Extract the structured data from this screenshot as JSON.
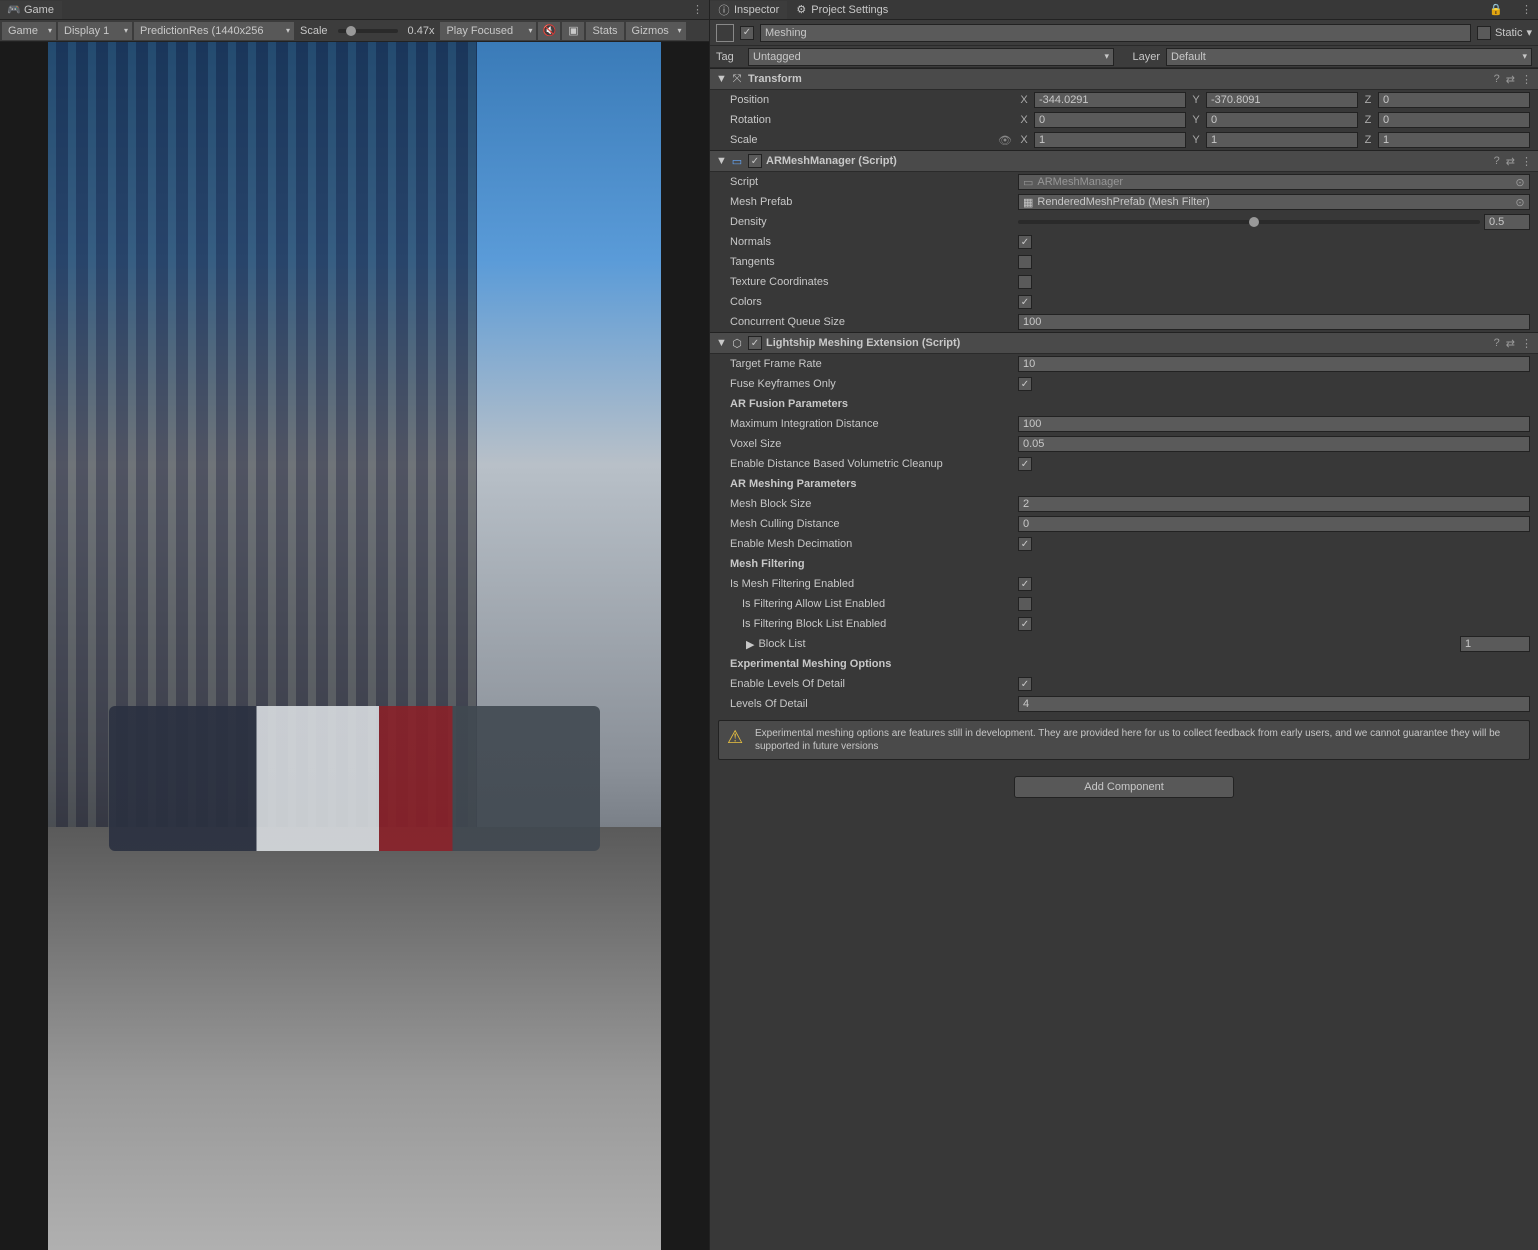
{
  "game_tab": {
    "label": "Game"
  },
  "game_toolbar": {
    "mode": "Game",
    "display": "Display 1",
    "resolution": "PredictionRes (1440x256",
    "scale_label": "Scale",
    "scale_value": "0.47x",
    "play_mode": "Play Focused",
    "stats": "Stats",
    "gizmos": "Gizmos"
  },
  "inspector_tab": {
    "label": "Inspector"
  },
  "settings_tab": {
    "label": "Project Settings"
  },
  "object": {
    "enabled": true,
    "name": "Meshing",
    "static_label": "Static",
    "tag_label": "Tag",
    "tag": "Untagged",
    "layer_label": "Layer",
    "layer": "Default"
  },
  "transform": {
    "title": "Transform",
    "position_label": "Position",
    "rotation_label": "Rotation",
    "scale_label": "Scale",
    "pos": {
      "x": "-344.0291",
      "y": "-370.8091",
      "z": "0"
    },
    "rot": {
      "x": "0",
      "y": "0",
      "z": "0"
    },
    "scale": {
      "x": "1",
      "y": "1",
      "z": "1"
    }
  },
  "armesh": {
    "title": "ARMeshManager (Script)",
    "script_label": "Script",
    "script_value": "ARMeshManager",
    "mesh_prefab_label": "Mesh Prefab",
    "mesh_prefab_value": "RenderedMeshPrefab (Mesh Filter)",
    "density_label": "Density",
    "density_value": "0.5",
    "normals_label": "Normals",
    "tangents_label": "Tangents",
    "texcoords_label": "Texture Coordinates",
    "colors_label": "Colors",
    "queue_label": "Concurrent Queue Size",
    "queue_value": "100"
  },
  "lightship": {
    "title": "Lightship Meshing Extension (Script)",
    "target_fr_label": "Target Frame Rate",
    "target_fr_value": "10",
    "fuse_label": "Fuse Keyframes Only",
    "fusion_header": "AR Fusion Parameters",
    "max_int_label": "Maximum Integration Distance",
    "max_int_value": "100",
    "voxel_label": "Voxel Size",
    "voxel_value": "0.05",
    "vol_cleanup_label": "Enable Distance Based Volumetric Cleanup",
    "meshing_header": "AR Meshing Parameters",
    "block_size_label": "Mesh Block Size",
    "block_size_value": "2",
    "culling_label": "Mesh Culling Distance",
    "culling_value": "0",
    "decimation_label": "Enable Mesh Decimation",
    "filtering_header": "Mesh Filtering",
    "filtering_enabled_label": "Is Mesh Filtering Enabled",
    "allow_list_label": "Is Filtering Allow List Enabled",
    "block_list_enabled_label": "Is Filtering Block List Enabled",
    "block_list_label": "Block List",
    "block_list_count": "1",
    "experimental_header": "Experimental Meshing Options",
    "lod_enabled_label": "Enable Levels Of Detail",
    "lod_label": "Levels Of Detail",
    "lod_value": "4",
    "warning_text": "Experimental meshing options are features still in development. They are provided here for us to collect feedback from early users, and we cannot guarantee they will be supported in future versions"
  },
  "add_component_label": "Add Component"
}
